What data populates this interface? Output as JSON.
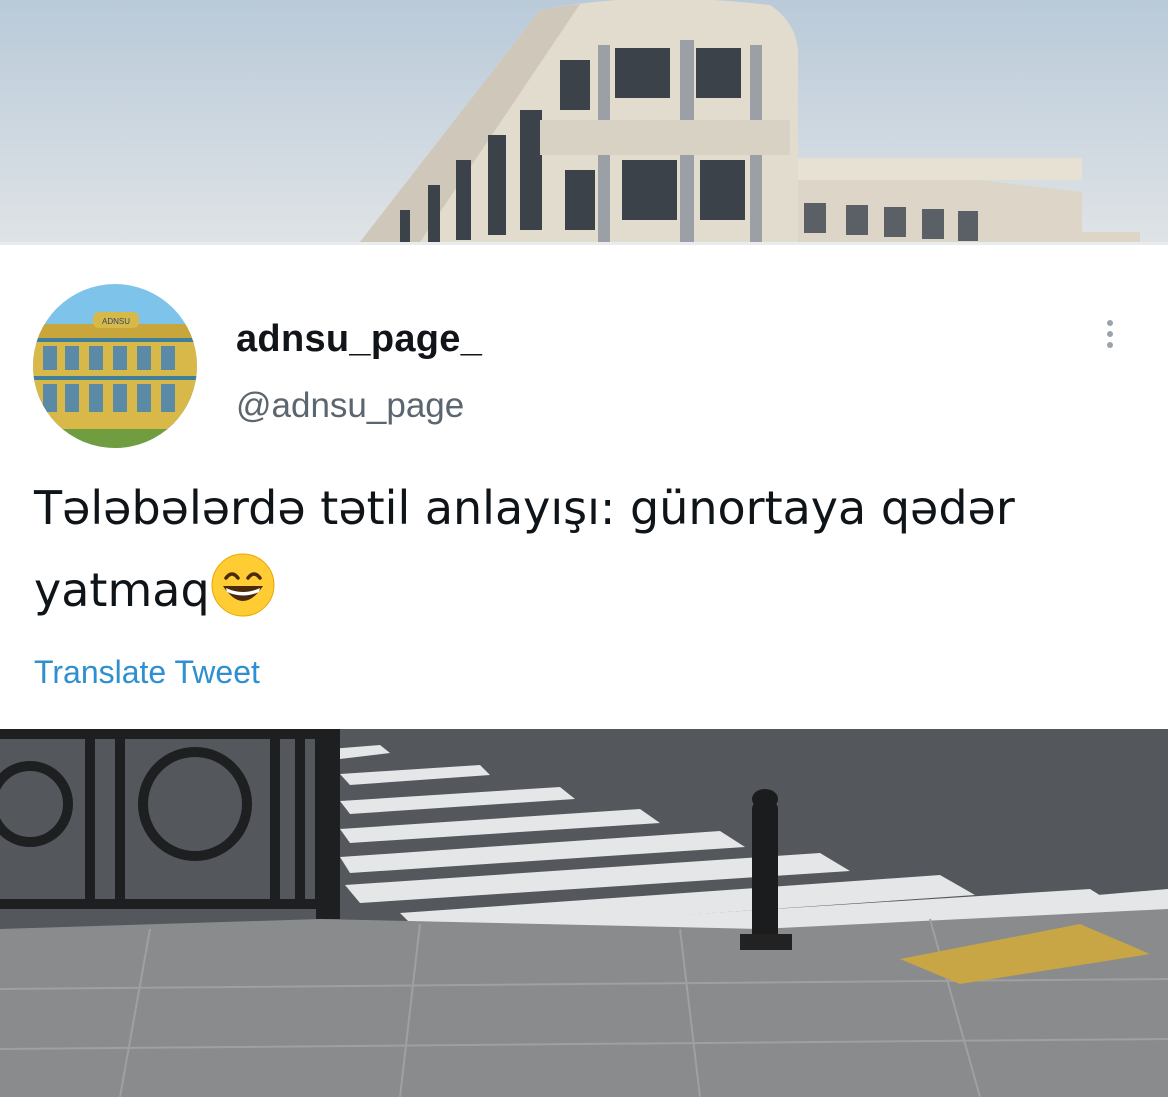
{
  "tweet": {
    "display_name": "adnsu_page_",
    "handle": "@adnsu_page",
    "text": "Tələbələrdə tətil anlayışı: günortaya qədər yatmaq",
    "emoji": "grinning-squinting-face-emoji",
    "translate_label": "Translate Tweet",
    "menu_icon": "more-dots-icon"
  },
  "avatar": {
    "building_sign": "ADNSU"
  },
  "colors": {
    "link": "#2f8fd0",
    "name": "#111418",
    "handle": "#5b6670",
    "card_bg": "#ffffff"
  }
}
